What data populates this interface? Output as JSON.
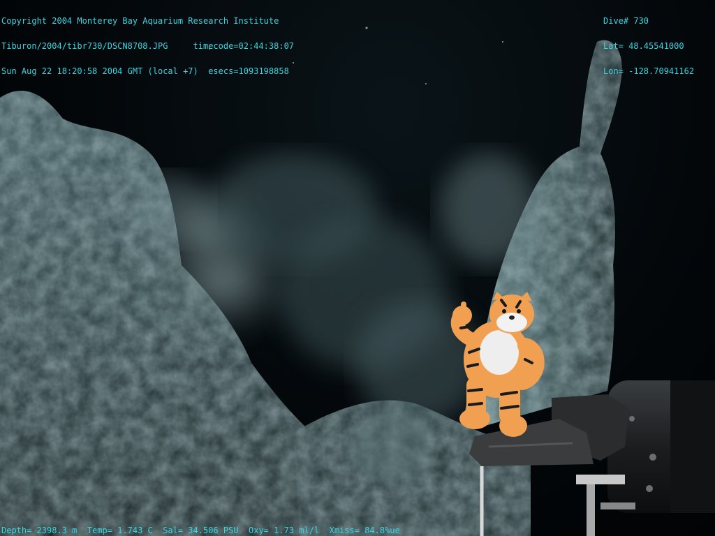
{
  "overlay": {
    "top_left": [
      "Copyright 2004 Monterey Bay Aquarium Research Institute",
      "Tiburon/2004/tibr730/DSCN8708.JPG     timecode=02:44:38:07",
      "Sun Aug 22 18:20:58 2004 GMT (local +7)  esecs=1093198858"
    ],
    "top_right": [
      "Dive# 730",
      "Lat= 48.45541000",
      "Lon= -128.70941162"
    ],
    "bottom": "Depth= 2398.3 m  Temp= 1.743 C  Sal= 34.506 PSU  Oxy= 1.73 ml/l  Xmiss= 84.8%ue"
  },
  "colors": {
    "overlay_text": "#38d6e0",
    "water": "#03070a",
    "rock": "#2f4448",
    "plume": "#6e8a8e",
    "figurine_orange": "#f0a050",
    "manipulator": "#1c1e20"
  },
  "scene_elements": [
    "hydrothermal-chimney",
    "black-smoker-plume",
    "tiger-figurine",
    "manipulator-arm"
  ]
}
